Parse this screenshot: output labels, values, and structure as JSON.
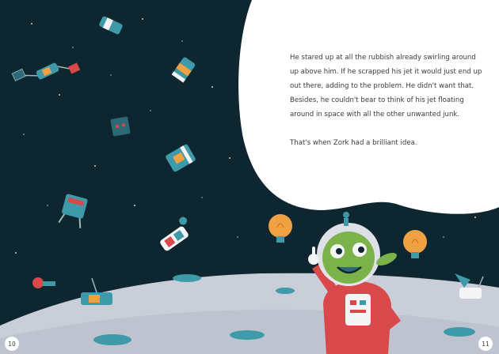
{
  "story": {
    "paragraph_1": "He stared up at all the rubbish already swirling around up above him. If he scrapped his jet it would just end up out there, adding to the problem. He didn't want that. Besides, he couldn't bear to think of his jet floating around in space with all the other unwanted junk.",
    "paragraph_2": "That's when Zork had a brilliant idea."
  },
  "page_numbers": {
    "left": "10",
    "right": "11"
  },
  "colors": {
    "space": "#0d2630",
    "moon_surface": "#c9ced8",
    "crater": "#3e9aa8",
    "speech_bubble": "#ffffff",
    "idea_bulb": "#f0a142",
    "suit_red": "#d9484b",
    "alien_green": "#7cb24a"
  },
  "illustration": {
    "characters": [
      "alien-astronaut"
    ],
    "objects": [
      "satellite",
      "space-junk",
      "lightbulb",
      "crater",
      "star"
    ]
  }
}
